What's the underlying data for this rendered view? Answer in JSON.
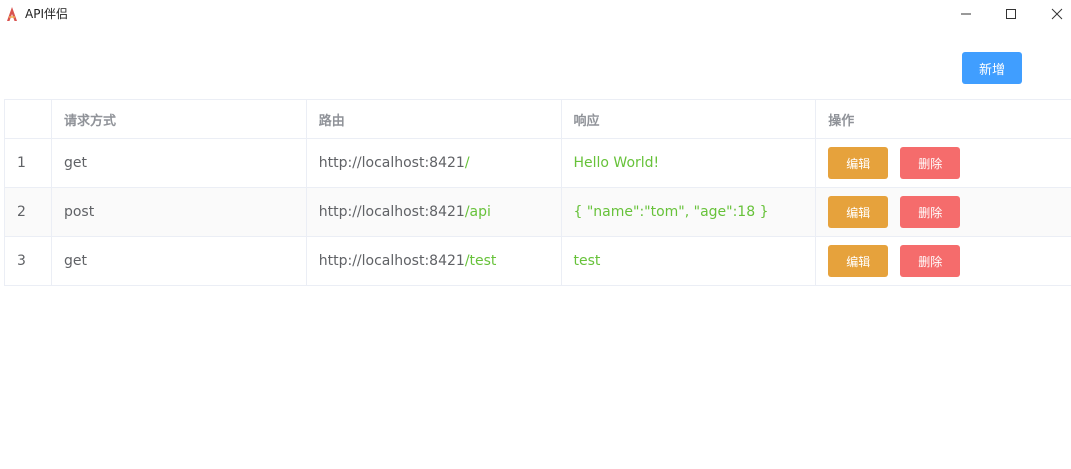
{
  "window": {
    "title": "API伴侣",
    "icon": "app-logo-icon",
    "controls": [
      "minimize-icon",
      "maximize-icon",
      "close-icon"
    ]
  },
  "toolbar": {
    "add_label": "新增",
    "add_color": "#409eff"
  },
  "table": {
    "headers": [
      "",
      "请求方式",
      "路由",
      "响应",
      "操作"
    ],
    "rows": [
      {
        "index": "1",
        "method": "get",
        "route_base": "http://localhost:8421",
        "route_path": "/",
        "response": "Hello World!",
        "edit": "编辑",
        "delete": "删除"
      },
      {
        "index": "2",
        "method": "post",
        "route_base": "http://localhost:8421",
        "route_path": "/api",
        "response": "{ \"name\":\"tom\", \"age\":18 }",
        "edit": "编辑",
        "delete": "删除"
      },
      {
        "index": "3",
        "method": "get",
        "route_base": "http://localhost:8421",
        "route_path": "/test",
        "response": "test",
        "edit": "编辑",
        "delete": "删除"
      }
    ]
  },
  "colors": {
    "edit_button": "#e6a23c",
    "delete_button": "#f56c6c",
    "highlight_text": "#67c23a"
  }
}
